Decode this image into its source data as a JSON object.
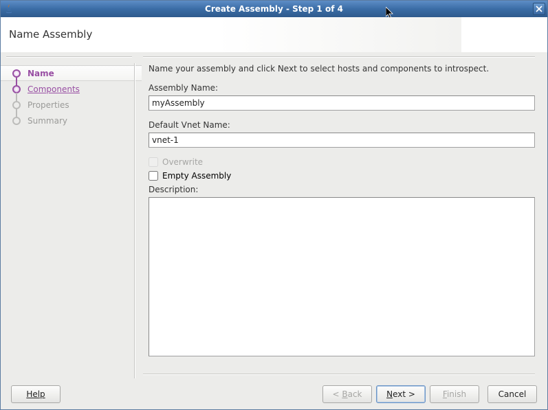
{
  "window": {
    "title": "Create Assembly - Step 1 of 4"
  },
  "header": {
    "title": "Name Assembly"
  },
  "sidebar": {
    "steps": [
      {
        "label": "Name"
      },
      {
        "label": "Components"
      },
      {
        "label": "Properties"
      },
      {
        "label": "Summary"
      }
    ]
  },
  "main": {
    "instruction": "Name your assembly and click Next to select hosts and components to introspect.",
    "assembly_name_label": "Assembly Name:",
    "assembly_name_value": "myAssembly",
    "vnet_label": "Default Vnet Name:",
    "vnet_value": "vnet-1",
    "overwrite_label": "Overwrite",
    "empty_label": "Empty Assembly",
    "description_label": "Description:",
    "description_value": ""
  },
  "footer": {
    "help": "Help",
    "back_prefix": "< ",
    "back_char": "B",
    "back_rest": "ack",
    "next_char": "N",
    "next_rest": "ext >",
    "finish_char": "F",
    "finish_rest": "inish",
    "cancel": "Cancel"
  }
}
